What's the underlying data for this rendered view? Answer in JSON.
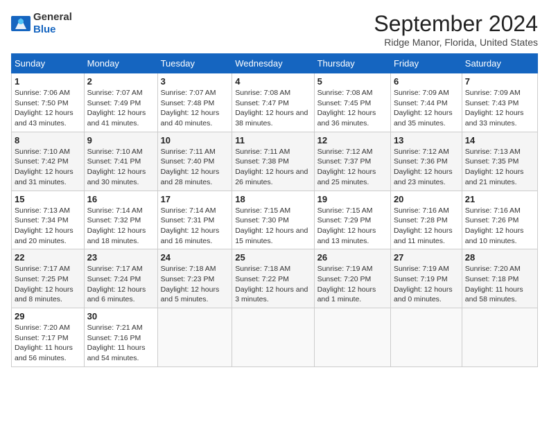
{
  "logo": {
    "text_general": "General",
    "text_blue": "Blue"
  },
  "title": "September 2024",
  "subtitle": "Ridge Manor, Florida, United States",
  "days_of_week": [
    "Sunday",
    "Monday",
    "Tuesday",
    "Wednesday",
    "Thursday",
    "Friday",
    "Saturday"
  ],
  "weeks": [
    [
      {
        "day": "1",
        "sunrise": "7:06 AM",
        "sunset": "7:50 PM",
        "daylight": "12 hours and 43 minutes."
      },
      {
        "day": "2",
        "sunrise": "7:07 AM",
        "sunset": "7:49 PM",
        "daylight": "12 hours and 41 minutes."
      },
      {
        "day": "3",
        "sunrise": "7:07 AM",
        "sunset": "7:48 PM",
        "daylight": "12 hours and 40 minutes."
      },
      {
        "day": "4",
        "sunrise": "7:08 AM",
        "sunset": "7:47 PM",
        "daylight": "12 hours and 38 minutes."
      },
      {
        "day": "5",
        "sunrise": "7:08 AM",
        "sunset": "7:45 PM",
        "daylight": "12 hours and 36 minutes."
      },
      {
        "day": "6",
        "sunrise": "7:09 AM",
        "sunset": "7:44 PM",
        "daylight": "12 hours and 35 minutes."
      },
      {
        "day": "7",
        "sunrise": "7:09 AM",
        "sunset": "7:43 PM",
        "daylight": "12 hours and 33 minutes."
      }
    ],
    [
      {
        "day": "8",
        "sunrise": "7:10 AM",
        "sunset": "7:42 PM",
        "daylight": "12 hours and 31 minutes."
      },
      {
        "day": "9",
        "sunrise": "7:10 AM",
        "sunset": "7:41 PM",
        "daylight": "12 hours and 30 minutes."
      },
      {
        "day": "10",
        "sunrise": "7:11 AM",
        "sunset": "7:40 PM",
        "daylight": "12 hours and 28 minutes."
      },
      {
        "day": "11",
        "sunrise": "7:11 AM",
        "sunset": "7:38 PM",
        "daylight": "12 hours and 26 minutes."
      },
      {
        "day": "12",
        "sunrise": "7:12 AM",
        "sunset": "7:37 PM",
        "daylight": "12 hours and 25 minutes."
      },
      {
        "day": "13",
        "sunrise": "7:12 AM",
        "sunset": "7:36 PM",
        "daylight": "12 hours and 23 minutes."
      },
      {
        "day": "14",
        "sunrise": "7:13 AM",
        "sunset": "7:35 PM",
        "daylight": "12 hours and 21 minutes."
      }
    ],
    [
      {
        "day": "15",
        "sunrise": "7:13 AM",
        "sunset": "7:34 PM",
        "daylight": "12 hours and 20 minutes."
      },
      {
        "day": "16",
        "sunrise": "7:14 AM",
        "sunset": "7:32 PM",
        "daylight": "12 hours and 18 minutes."
      },
      {
        "day": "17",
        "sunrise": "7:14 AM",
        "sunset": "7:31 PM",
        "daylight": "12 hours and 16 minutes."
      },
      {
        "day": "18",
        "sunrise": "7:15 AM",
        "sunset": "7:30 PM",
        "daylight": "12 hours and 15 minutes."
      },
      {
        "day": "19",
        "sunrise": "7:15 AM",
        "sunset": "7:29 PM",
        "daylight": "12 hours and 13 minutes."
      },
      {
        "day": "20",
        "sunrise": "7:16 AM",
        "sunset": "7:28 PM",
        "daylight": "12 hours and 11 minutes."
      },
      {
        "day": "21",
        "sunrise": "7:16 AM",
        "sunset": "7:26 PM",
        "daylight": "12 hours and 10 minutes."
      }
    ],
    [
      {
        "day": "22",
        "sunrise": "7:17 AM",
        "sunset": "7:25 PM",
        "daylight": "12 hours and 8 minutes."
      },
      {
        "day": "23",
        "sunrise": "7:17 AM",
        "sunset": "7:24 PM",
        "daylight": "12 hours and 6 minutes."
      },
      {
        "day": "24",
        "sunrise": "7:18 AM",
        "sunset": "7:23 PM",
        "daylight": "12 hours and 5 minutes."
      },
      {
        "day": "25",
        "sunrise": "7:18 AM",
        "sunset": "7:22 PM",
        "daylight": "12 hours and 3 minutes."
      },
      {
        "day": "26",
        "sunrise": "7:19 AM",
        "sunset": "7:20 PM",
        "daylight": "12 hours and 1 minute."
      },
      {
        "day": "27",
        "sunrise": "7:19 AM",
        "sunset": "7:19 PM",
        "daylight": "12 hours and 0 minutes."
      },
      {
        "day": "28",
        "sunrise": "7:20 AM",
        "sunset": "7:18 PM",
        "daylight": "11 hours and 58 minutes."
      }
    ],
    [
      {
        "day": "29",
        "sunrise": "7:20 AM",
        "sunset": "7:17 PM",
        "daylight": "11 hours and 56 minutes."
      },
      {
        "day": "30",
        "sunrise": "7:21 AM",
        "sunset": "7:16 PM",
        "daylight": "11 hours and 54 minutes."
      },
      null,
      null,
      null,
      null,
      null
    ]
  ],
  "labels": {
    "sunrise": "Sunrise:",
    "sunset": "Sunset:",
    "daylight": "Daylight:"
  }
}
